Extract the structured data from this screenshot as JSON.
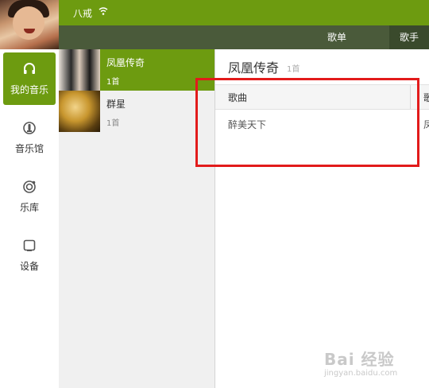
{
  "user": {
    "name": "八戒"
  },
  "subtabs": [
    {
      "label": "歌单"
    },
    {
      "label": "歌手"
    }
  ],
  "leftnav": [
    {
      "label": "我的音乐",
      "icon": "headphones-icon",
      "active": true
    },
    {
      "label": "音乐馆",
      "icon": "music-hall-icon",
      "active": false
    },
    {
      "label": "乐库",
      "icon": "library-icon",
      "active": false
    },
    {
      "label": "设备",
      "icon": "device-icon",
      "active": false
    }
  ],
  "playlists": [
    {
      "name": "凤凰传奇",
      "count": "1首",
      "active": true
    },
    {
      "name": "群星",
      "count": "1首",
      "active": false
    }
  ],
  "main": {
    "title": "凤凰传奇",
    "count": "1首",
    "columns": [
      "歌曲",
      "歌"
    ],
    "rows": [
      {
        "song": "醉美天下",
        "partial": "凤"
      }
    ]
  },
  "watermark": {
    "logo": "Bai 经验",
    "url": "jingyan.baidu.com"
  },
  "colors": {
    "brand": "#6d9b10",
    "highlight": "#e21b1b"
  }
}
